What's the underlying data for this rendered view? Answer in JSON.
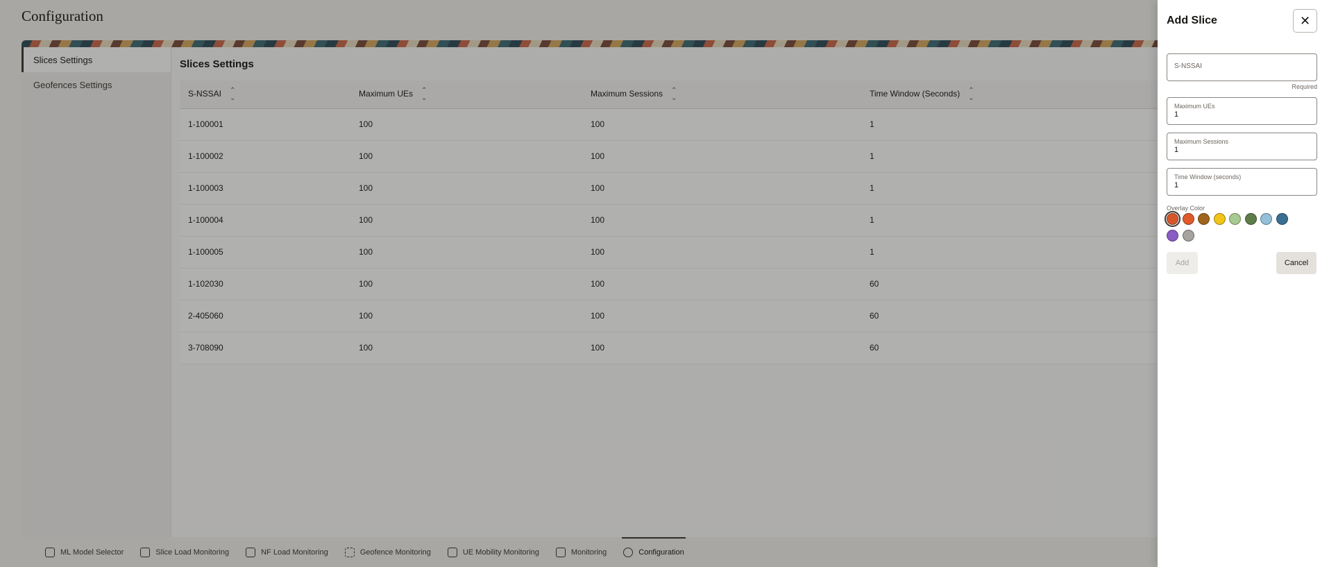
{
  "page": {
    "title": "Configuration"
  },
  "sidenav": {
    "items": [
      {
        "label": "Slices Settings",
        "active": true
      },
      {
        "label": "Geofences Settings",
        "active": false
      }
    ]
  },
  "section": {
    "title": "Slices Settings"
  },
  "table": {
    "columns": [
      "S-NSSAI",
      "Maximum UEs",
      "Maximum Sessions",
      "Time Window (Seconds)"
    ],
    "rows": [
      [
        "1-100001",
        "100",
        "100",
        "1"
      ],
      [
        "1-100002",
        "100",
        "100",
        "1"
      ],
      [
        "1-100003",
        "100",
        "100",
        "1"
      ],
      [
        "1-100004",
        "100",
        "100",
        "1"
      ],
      [
        "1-100005",
        "100",
        "100",
        "1"
      ],
      [
        "1-102030",
        "100",
        "100",
        "60"
      ],
      [
        "2-405060",
        "100",
        "100",
        "60"
      ],
      [
        "3-708090",
        "100",
        "100",
        "60"
      ]
    ]
  },
  "tabbar": {
    "tabs": [
      {
        "label": "ML Model Selector",
        "icon": "cube-icon"
      },
      {
        "label": "Slice Load Monitoring",
        "icon": "monitor-chart-icon"
      },
      {
        "label": "NF Load Monitoring",
        "icon": "network-icon"
      },
      {
        "label": "Geofence Monitoring",
        "icon": "geofence-icon"
      },
      {
        "label": "UE Mobility Monitoring",
        "icon": "mobility-icon"
      },
      {
        "label": "Monitoring",
        "icon": "chart-icon"
      },
      {
        "label": "Configuration",
        "icon": "gear-icon",
        "active": true
      }
    ]
  },
  "drawer": {
    "title": "Add Slice",
    "close_glyph": "✕",
    "snssai": {
      "placeholder": "S-NSSAI",
      "hint": "Required"
    },
    "max_ues": {
      "label": "Maximum UEs",
      "value": "1"
    },
    "max_sessions": {
      "label": "Maximum Sessions",
      "value": "1"
    },
    "time_window": {
      "label": "Time Window (seconds)",
      "value": "1"
    },
    "overlay": {
      "label": "Overlay Color",
      "colors": [
        "#d8572a",
        "#e05a2b",
        "#a0651d",
        "#f0c419",
        "#a8c98f",
        "#5e7d4a",
        "#93bfd8",
        "#3a6f91",
        "#8a5cc4",
        "#a7a39e"
      ],
      "selected_index": 0
    },
    "add_label": "Add",
    "cancel_label": "Cancel"
  }
}
